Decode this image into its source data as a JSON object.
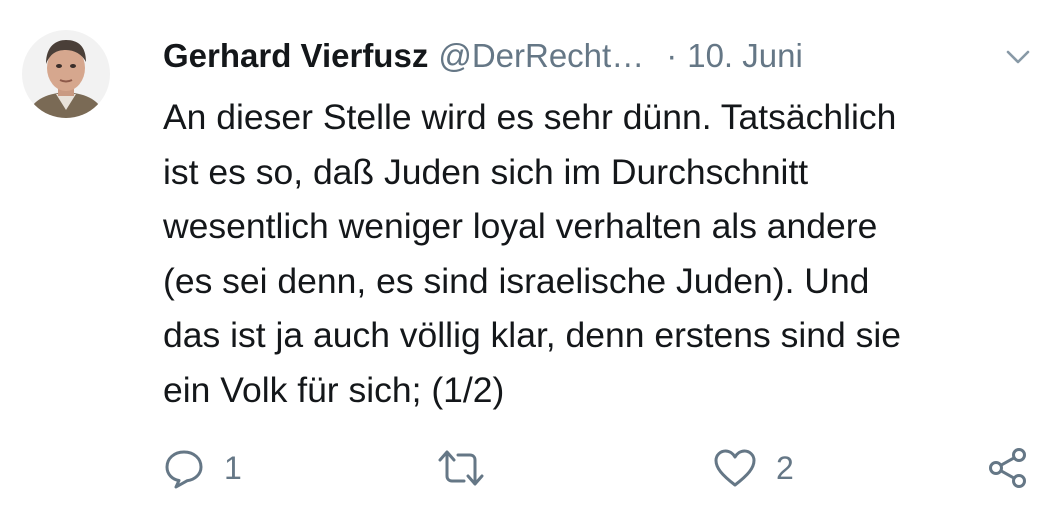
{
  "tweet": {
    "author": {
      "display_name": "Gerhard Vierfusz",
      "handle": "@DerRecht…"
    },
    "separator": "·",
    "date": "10. Juni",
    "text_lines": [
      "An dieser Stelle wird es sehr dünn. Tatsächlich",
      "ist es so, daß Juden sich im Durchschnitt",
      "wesentlich weniger loyal verhalten als andere",
      "(es sei denn, es sind israelische Juden). Und",
      "das ist ja auch völlig klar, denn erstens sind sie",
      "ein Volk für sich; (1/2)"
    ],
    "actions": {
      "reply_count": "1",
      "retweet_count": "",
      "like_count": "2"
    }
  },
  "icons": {
    "avatar": "profile-photo",
    "caret": "chevron-down-icon",
    "reply": "reply-icon",
    "retweet": "retweet-icon",
    "like": "heart-icon",
    "share": "share-icon"
  },
  "colors": {
    "text_primary": "#14171a",
    "text_secondary": "#657786",
    "background": "#ffffff"
  }
}
